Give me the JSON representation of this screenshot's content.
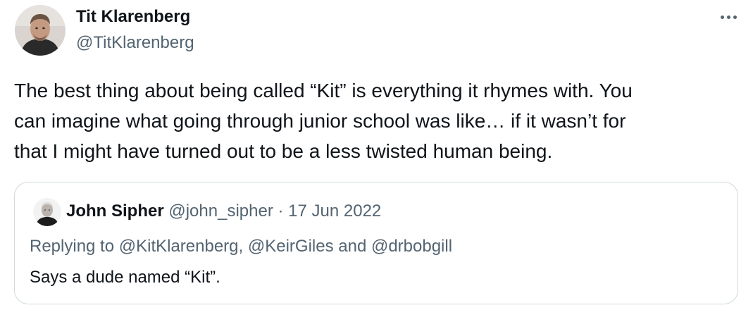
{
  "tweet": {
    "author": {
      "display_name": "Tit Klarenberg",
      "handle": "@TitKlarenberg",
      "avatar_icon": "user-avatar-photo"
    },
    "more_icon": "more-options-icon",
    "text_lines": [
      "The best thing about being called “Kit” is everything it rhymes with.  You",
      "can imagine what going through junior school was like… if it wasn’t for",
      "that I might have turned out to be a less twisted human being."
    ]
  },
  "quoted_tweet": {
    "author": {
      "display_name": "John Sipher",
      "handle": "@john_sipher",
      "avatar_icon": "user-avatar-photo"
    },
    "separator": "·",
    "date": "17 Jun 2022",
    "replying_to": "Replying to @KitKlarenberg, @KeirGiles and @drbobgill",
    "text": "Says a dude named “Kit”."
  },
  "colors": {
    "text_primary": "#0f1419",
    "text_secondary": "#536471",
    "border": "#cfd9de",
    "background": "#ffffff"
  }
}
